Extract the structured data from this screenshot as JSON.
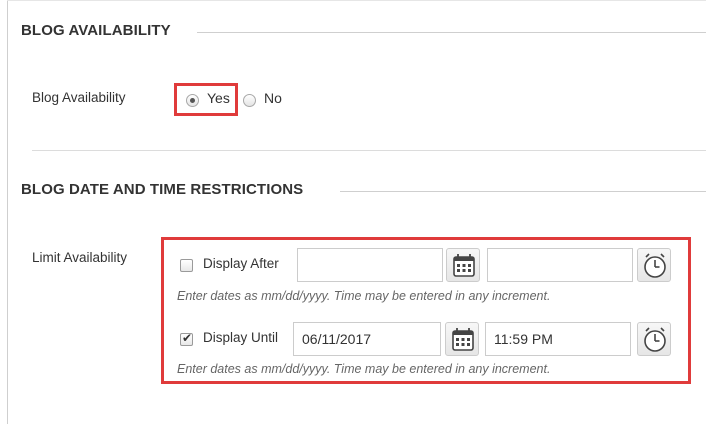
{
  "sections": {
    "availability": {
      "heading": "BLOG AVAILABILITY",
      "field_label": "Blog Availability",
      "options": [
        {
          "label": "Yes",
          "selected": true
        },
        {
          "label": "No",
          "selected": false
        }
      ]
    },
    "restrictions": {
      "heading": "BLOG DATE AND TIME RESTRICTIONS",
      "field_label": "Limit Availability",
      "display_after": {
        "label": "Display After",
        "checked": false,
        "date_value": "",
        "time_value": "",
        "hint": "Enter dates as mm/dd/yyyy. Time may be entered in any increment."
      },
      "display_until": {
        "label": "Display Until",
        "checked": true,
        "date_value": "06/11/2017",
        "time_value": "11:59 PM",
        "hint": "Enter dates as mm/dd/yyyy. Time may be entered in any increment."
      }
    }
  },
  "icons": {
    "date_picker": "calendar-icon",
    "time_picker": "clock-icon",
    "checkmark": "✔"
  },
  "colors": {
    "highlight": "#e03b3b",
    "text": "#333333",
    "hint": "#666666",
    "border": "#cccccc"
  }
}
